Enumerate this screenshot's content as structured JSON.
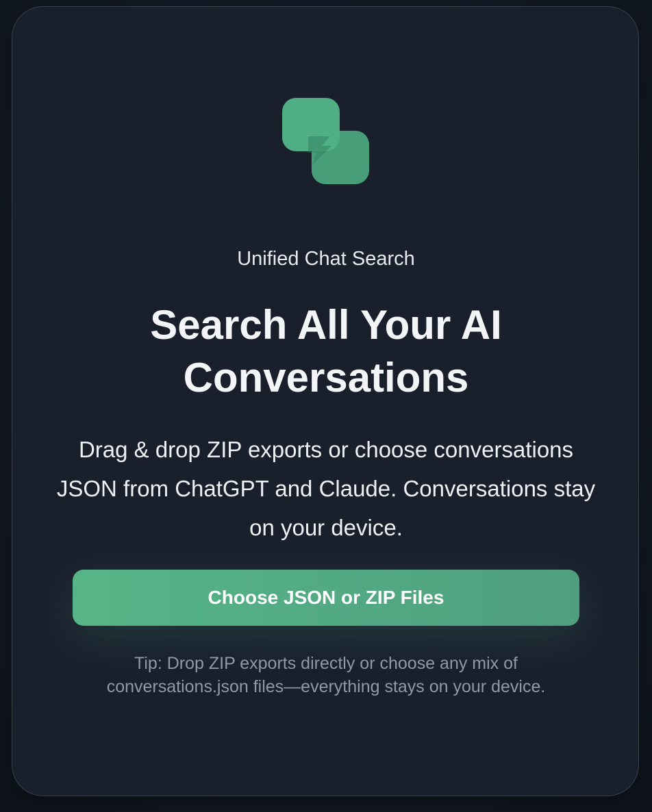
{
  "app": {
    "eyebrow": "Unified Chat Search",
    "headline": "Search All Your AI Conversations",
    "description": "Drag & drop ZIP exports or choose conversations JSON from ChatGPT and Claude. Conversations stay on your device.",
    "cta_label": "Choose JSON or ZIP Files",
    "tip": "Tip: Drop ZIP exports directly or choose any mix of conversations.json files—everything stays on your device."
  },
  "logo": {
    "icon": "overlapping-chat-bubbles-icon"
  },
  "colors": {
    "accent": "#50b085",
    "background": "#1a1f2c",
    "card_border": "#3a414d",
    "muted_text": "#9099a7"
  }
}
